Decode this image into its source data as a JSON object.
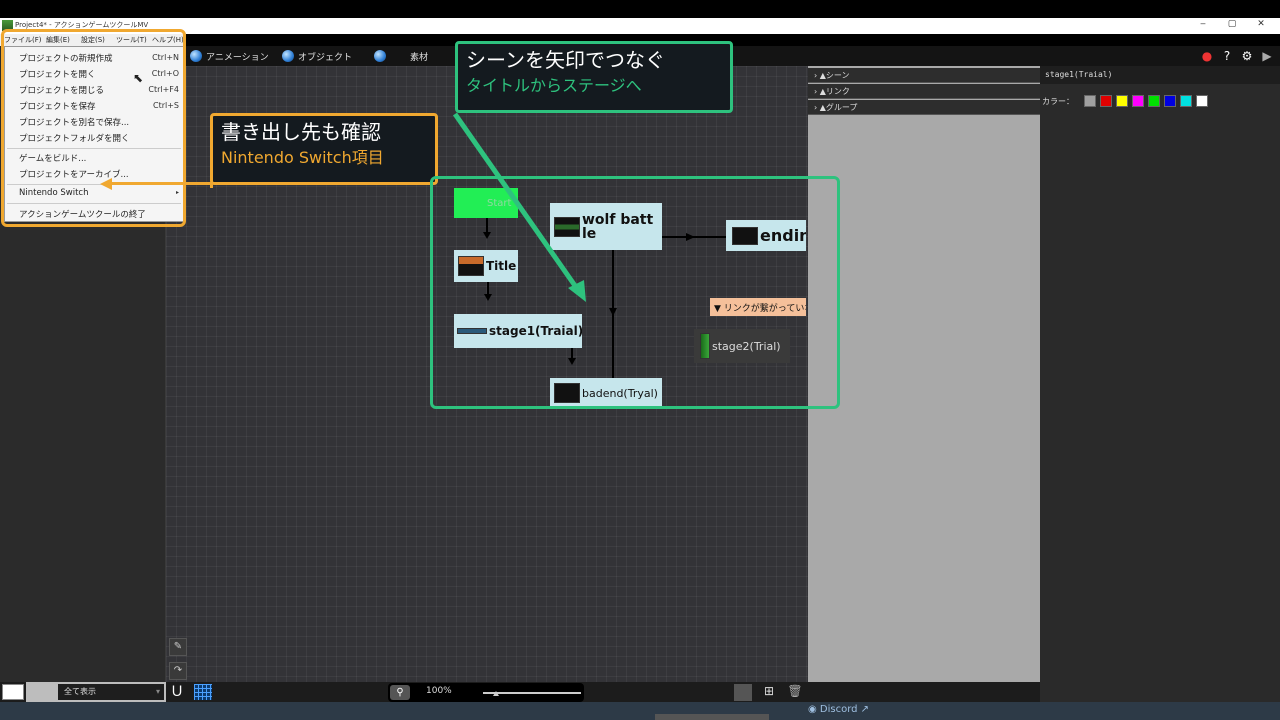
{
  "window": {
    "title": "Project4* - アクションゲームツクールMV",
    "minimize": "‒",
    "maximize": "▢",
    "close": "✕"
  },
  "menubar": [
    "ファイル(F)",
    "編集(E)",
    "設定(S)",
    "ツール(T)",
    "ヘルプ(H)"
  ],
  "toolbar": {
    "tabs": [
      "アニメーション",
      "オブジェクト",
      "素材"
    ],
    "icons": [
      "record-icon",
      "help-icon",
      "gear-icon",
      "play-icon"
    ]
  },
  "file_menu": [
    {
      "label": "プロジェクトの新規作成",
      "shortcut": "Ctrl+N"
    },
    {
      "label": "プロジェクトを開く",
      "shortcut": "Ctrl+O"
    },
    {
      "label": "プロジェクトを閉じる",
      "shortcut": "Ctrl+F4"
    },
    {
      "label": "プロジェクトを保存",
      "shortcut": "Ctrl+S"
    },
    {
      "label": "プロジェクトを別名で保存...",
      "shortcut": ""
    },
    {
      "label": "プロジェクトフォルダを開く",
      "shortcut": ""
    },
    {
      "label": "ゲームをビルド...",
      "shortcut": ""
    },
    {
      "label": "プロジェクトをアーカイブ...",
      "shortcut": ""
    },
    {
      "label": "Nintendo Switch",
      "shortcut": "▸"
    },
    {
      "label": "アクションゲームツクールの終了",
      "shortcut": ""
    }
  ],
  "callouts": {
    "export": {
      "title": "書き出し先も確認",
      "subtitle": "Nintendo Switch項目",
      "color": "#f0a830"
    },
    "scene": {
      "title": "シーンを矢印でつなぐ",
      "subtitle": "タイトルからステージへ",
      "color": "#2ec27e"
    }
  },
  "scenes": {
    "start": "Start",
    "title": "Title",
    "wolf": "wolf batt\nle",
    "ending": "endin",
    "stage1": "stage1(Traial)",
    "badend": "badend(Tryal)",
    "stage2": "stage2(Trial)",
    "warning": "▼ リンクが繋がっていな"
  },
  "right_panel": {
    "categories": [
      "シーン",
      "リンク",
      "グループ"
    ]
  },
  "properties": {
    "name": "stage1(Traial)",
    "color_label": "カラー：",
    "colors": [
      "#a0a0a0",
      "#e00000",
      "#ffff00",
      "#ff00ff",
      "#00e000",
      "#0000e0",
      "#00e0e0",
      "#ffffff"
    ]
  },
  "bottom": {
    "show_all": "全て表示",
    "zoom": "100%",
    "discord": "Discord"
  }
}
